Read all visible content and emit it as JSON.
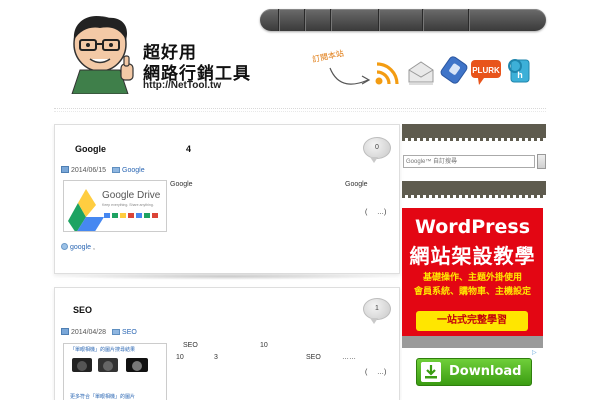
{
  "site": {
    "title_line1": "超好用",
    "title_line2": "網路行銷工具",
    "url": "http://NetTool.tw"
  },
  "subscribe": {
    "label": "訂閱本站",
    "icons": [
      "rss-icon",
      "mail-icon",
      "delicious-icon",
      "plurk-icon",
      "hemidemi-icon"
    ],
    "plurk_label": "PLURK"
  },
  "posts": [
    {
      "title": "Google",
      "title_num": "4",
      "comments": "0",
      "date": "2014/06/15",
      "category": "Google",
      "thumb_title": "Google Drive",
      "thumb_sub": "Keep everything. Share anything.",
      "excerpt_left": "Google",
      "excerpt_right": "Google",
      "more_open": "(",
      "more_dots": "…)",
      "tag": "google",
      "tag_sep": ","
    },
    {
      "title": "SEO",
      "comments": "1",
      "date": "2014/04/28",
      "category": "SEO",
      "thumb_caption": "「單眼相機」的圖片搜尋結果",
      "thumb_more": "更多符合「單眼相機」的圖片",
      "line1_link": "SEO",
      "line1_num": "10",
      "line2_a": "10",
      "line2_b": "3",
      "line2_c": "SEO",
      "line2_d": "……",
      "more_open": "(",
      "more_dots": "…)"
    }
  ],
  "sidebar": {
    "search_placeholder": "Google™ 自訂搜尋",
    "ad": {
      "line1": "WordPress",
      "line2": "網站架設教學",
      "line3": "基礎操作、主題外掛使用",
      "line4": "會員系統、購物車、主機設定",
      "cta": "一站式完整學習"
    },
    "download_label": "Download"
  },
  "colors": {
    "nav_bar": "#4a4a4a",
    "sidebar_head": "#5e5b4e",
    "ad_red": "#e30613",
    "ad_yellow": "#ffe600",
    "link_blue": "#2a66b3",
    "download_green": "#4fb520"
  }
}
